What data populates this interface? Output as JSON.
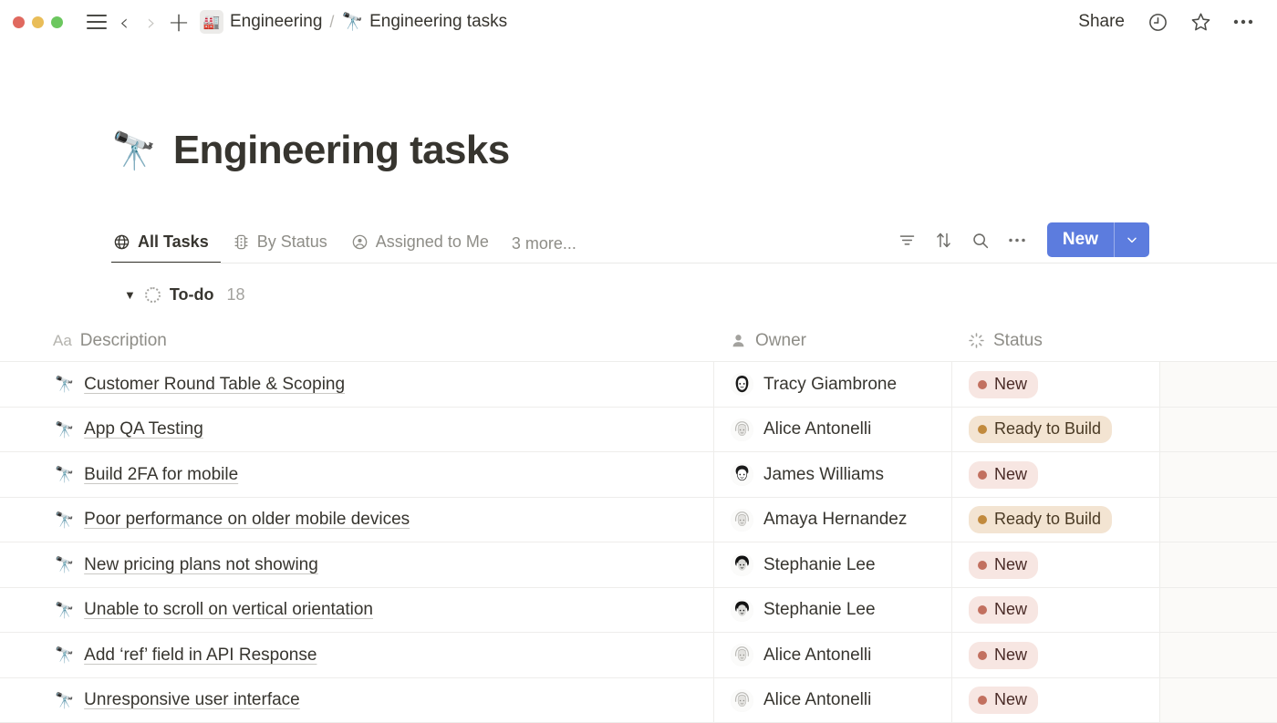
{
  "window": {
    "traffic_lights": [
      "close",
      "minimize",
      "zoom"
    ],
    "nav": {
      "menu": "menu-icon",
      "back": "back-chevron-icon",
      "forward": "forward-chevron-icon",
      "new": "plus-icon"
    },
    "breadcrumb": [
      {
        "icon": "🏭",
        "label": "Engineering"
      },
      {
        "icon": "🔭",
        "label": "Engineering tasks"
      }
    ],
    "breadcrumb_separator": "/",
    "actions": {
      "share_label": "Share",
      "history_icon": "clock-icon",
      "favorite_icon": "star-icon",
      "more_icon": "ellipsis-icon"
    }
  },
  "page": {
    "emoji": "🔭",
    "title": "Engineering tasks"
  },
  "tabs": [
    {
      "label": "All Tasks",
      "icon": "globe-icon",
      "active": true
    },
    {
      "label": "By Status",
      "icon": "traffic-light-icon",
      "active": false
    },
    {
      "label": "Assigned to Me",
      "icon": "person-circle-icon",
      "active": false
    }
  ],
  "tabs_more_label": "3 more...",
  "toolbar": {
    "filter_icon": "filter-icon",
    "sort_icon": "sort-icon",
    "search_icon": "search-icon",
    "more_icon": "ellipsis-icon",
    "new_label": "New",
    "new_caret_icon": "chevron-down-icon",
    "accent_color": "#5c7cde"
  },
  "group": {
    "caret": "▼",
    "name": "To-do",
    "count": "18"
  },
  "table": {
    "columns": [
      {
        "key": "description",
        "label": "Description",
        "type_badge": "Aa",
        "icon": "text-icon"
      },
      {
        "key": "owner",
        "label": "Owner",
        "icon": "person-icon"
      },
      {
        "key": "status",
        "label": "Status",
        "icon": "status-spinner-icon"
      }
    ],
    "status_styles": {
      "New": {
        "bg": "#f7e6e2",
        "fg": "#4a2b27",
        "dot": "#c2705f"
      },
      "Ready to Build": {
        "bg": "#f3e4d2",
        "fg": "#4a3a24",
        "dot": "#c18a3d"
      }
    },
    "rows": [
      {
        "emoji": "🔭",
        "description": "Customer Round Table & Scoping",
        "owner": "Tracy Giambrone",
        "avatar": "tracy",
        "status": "New"
      },
      {
        "emoji": "🔭",
        "description": "App QA Testing",
        "owner": "Alice Antonelli",
        "avatar": "alice",
        "status": "Ready to Build"
      },
      {
        "emoji": "🔭",
        "description": "Build 2FA for mobile",
        "owner": "James Williams",
        "avatar": "james",
        "status": "New"
      },
      {
        "emoji": "🔭",
        "description": "Poor performance on older mobile devices",
        "owner": "Amaya Hernandez",
        "avatar": "alice",
        "status": "Ready to Build"
      },
      {
        "emoji": "🔭",
        "description": "New pricing plans not showing",
        "owner": "Stephanie Lee",
        "avatar": "stephanie",
        "status": "New"
      },
      {
        "emoji": "🔭",
        "description": "Unable to scroll on vertical orientation",
        "owner": "Stephanie Lee",
        "avatar": "stephanie",
        "status": "New"
      },
      {
        "emoji": "🔭",
        "description": "Add ‘ref’ field in API Response",
        "owner": "Alice Antonelli",
        "avatar": "alice",
        "status": "New"
      },
      {
        "emoji": "🔭",
        "description": "Unresponsive user interface",
        "owner": "Alice Antonelli",
        "avatar": "alice",
        "status": "New"
      }
    ]
  }
}
